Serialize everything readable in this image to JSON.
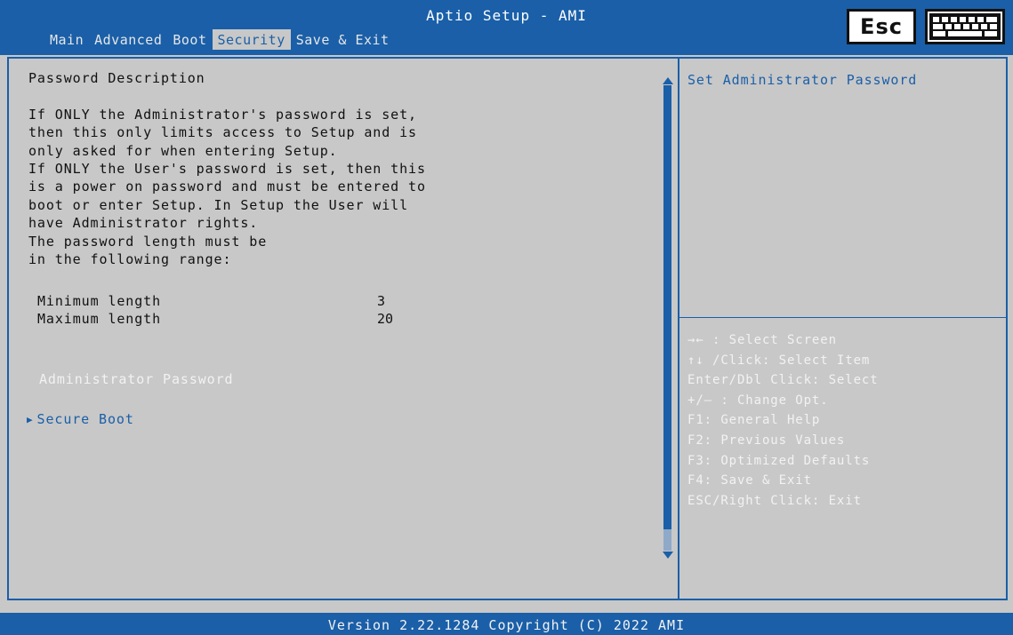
{
  "header": {
    "title": "Aptio Setup - AMI",
    "tabs": [
      {
        "label": "Main",
        "active": false
      },
      {
        "label": "Advanced",
        "active": false
      },
      {
        "label": "Boot",
        "active": false
      },
      {
        "label": "Security",
        "active": true
      },
      {
        "label": "Save & Exit",
        "active": false
      }
    ],
    "esc_label": "Esc",
    "keyboard_icon": "keyboard-icon"
  },
  "main": {
    "description_heading": "Password Description",
    "description_lines": [
      "If ONLY the Administrator's password is set,",
      "then this only limits access to Setup and is",
      "only asked for when entering Setup.",
      "If ONLY the User's password is set, then this",
      "is a power on password and must be entered to",
      "boot or enter Setup. In Setup the User will",
      "have Administrator rights.",
      "The password length must be",
      "in the following range:"
    ],
    "min_length_label": "Minimum length",
    "min_length_value": "3",
    "max_length_label": "Maximum length",
    "max_length_value": "20",
    "admin_password_label": "Administrator Password",
    "secure_boot_label": "Secure Boot"
  },
  "help": {
    "title": "Set Administrator Password",
    "keys": [
      "→← : Select Screen",
      "↑↓ /Click: Select Item",
      "Enter/Dbl Click: Select",
      "+/– : Change Opt.",
      "F1: General Help",
      "F2: Previous Values",
      "F3: Optimized Defaults",
      "F4: Save & Exit",
      "ESC/Right Click: Exit"
    ]
  },
  "footer": {
    "version": "Version 2.22.1284 Copyright (C) 2022 AMI"
  },
  "colors": {
    "accent": "#1a5fa8",
    "background": "#c8c8c8",
    "highlight_text": "#f2f2f2"
  }
}
